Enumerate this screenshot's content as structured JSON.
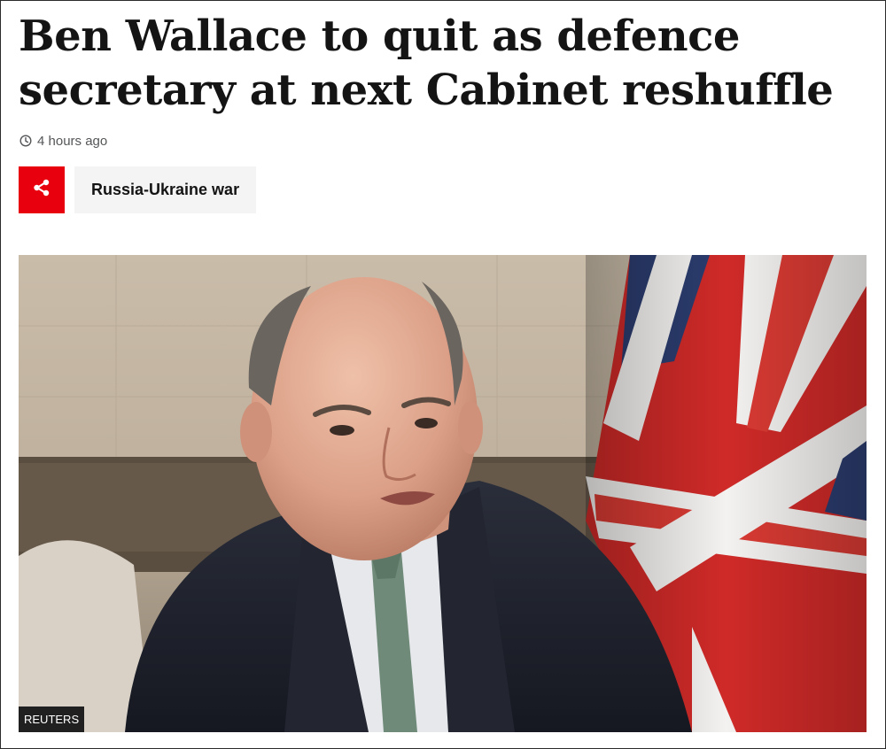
{
  "article": {
    "headline_line1": "Ben Wallace to quit as defence",
    "headline_line2": "secretary at next Cabinet reshuffle",
    "timestamp": "4 hours ago",
    "topic_tag": "Russia-Ukraine war"
  },
  "icons": {
    "timestamp": "clock-icon",
    "share": "share-icon"
  },
  "image": {
    "credit": "REUTERS"
  },
  "colors": {
    "share_button": "#e8000f",
    "topic_tag_bg": "#f4f4f4",
    "headline": "#141414"
  }
}
